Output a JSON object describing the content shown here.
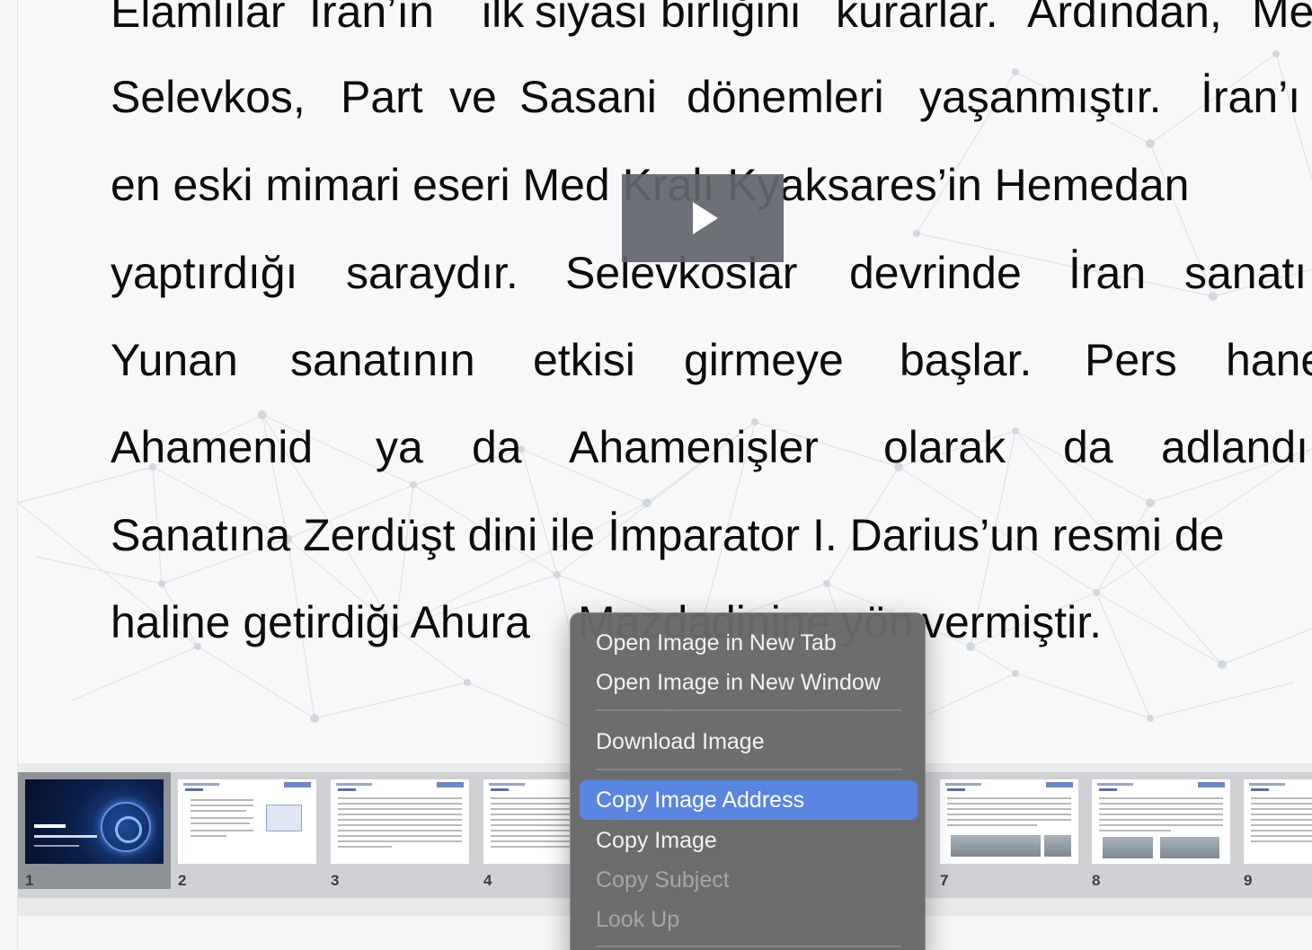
{
  "slide": {
    "lines": [
      [
        "Elamlılar",
        "İran’ın",
        "ilk",
        "siyasi",
        "birliğini",
        "kurarlar.",
        "Ardından,",
        "Me"
      ],
      [
        "Selevkos,",
        "Part",
        "ve",
        "Sasani",
        "dönemleri",
        "yaşanmıştır.",
        "İran’ı"
      ],
      [
        "en eski mimari eseri Med Kralı Kyaksares’in Hemedan"
      ],
      [
        "yaptırdığı",
        "saraydır.",
        "Selevkoslar",
        "devrinde",
        "İran",
        "sanatı"
      ],
      [
        "Yunan",
        "sanatının",
        "etkisi",
        "girmeye",
        "başlar.",
        "Pers",
        "hane"
      ],
      [
        "Ahamenid",
        "ya",
        "da",
        "Ahamenişler",
        "olarak",
        "da",
        "adlandı"
      ],
      [
        "Sanatına Zerdüşt dini ile İmparator I. Darius’un resmi de"
      ],
      [
        "haline getirdiği Ahura",
        "Mazda",
        "dinine",
        "yön",
        "vermiştir."
      ]
    ]
  },
  "video": {
    "icon": "play-icon"
  },
  "thumbnails": [
    {
      "number": "1",
      "active": true,
      "style": "title"
    },
    {
      "number": "2",
      "active": false,
      "style": "bullets-image"
    },
    {
      "number": "3",
      "active": false,
      "style": "text"
    },
    {
      "number": "4",
      "active": false,
      "style": "text"
    },
    {
      "number": "7",
      "active": false,
      "style": "text-photos"
    },
    {
      "number": "8",
      "active": false,
      "style": "text-photos"
    },
    {
      "number": "9",
      "active": false,
      "style": "text"
    }
  ],
  "context_menu": {
    "items": [
      {
        "label": "Open Image in New Tab",
        "state": "normal"
      },
      {
        "label": "Open Image in New Window",
        "state": "normal"
      },
      {
        "label": "Download Image",
        "state": "normal"
      },
      {
        "label": "Copy Image Address",
        "state": "highlighted"
      },
      {
        "label": "Copy Image",
        "state": "normal"
      },
      {
        "label": "Copy Subject",
        "state": "disabled"
      },
      {
        "label": "Look Up",
        "state": "disabled"
      }
    ]
  },
  "colors": {
    "menu_highlight": "#5a85e0",
    "menu_background": "#686868",
    "active_thumbnail": "#8e9196"
  }
}
